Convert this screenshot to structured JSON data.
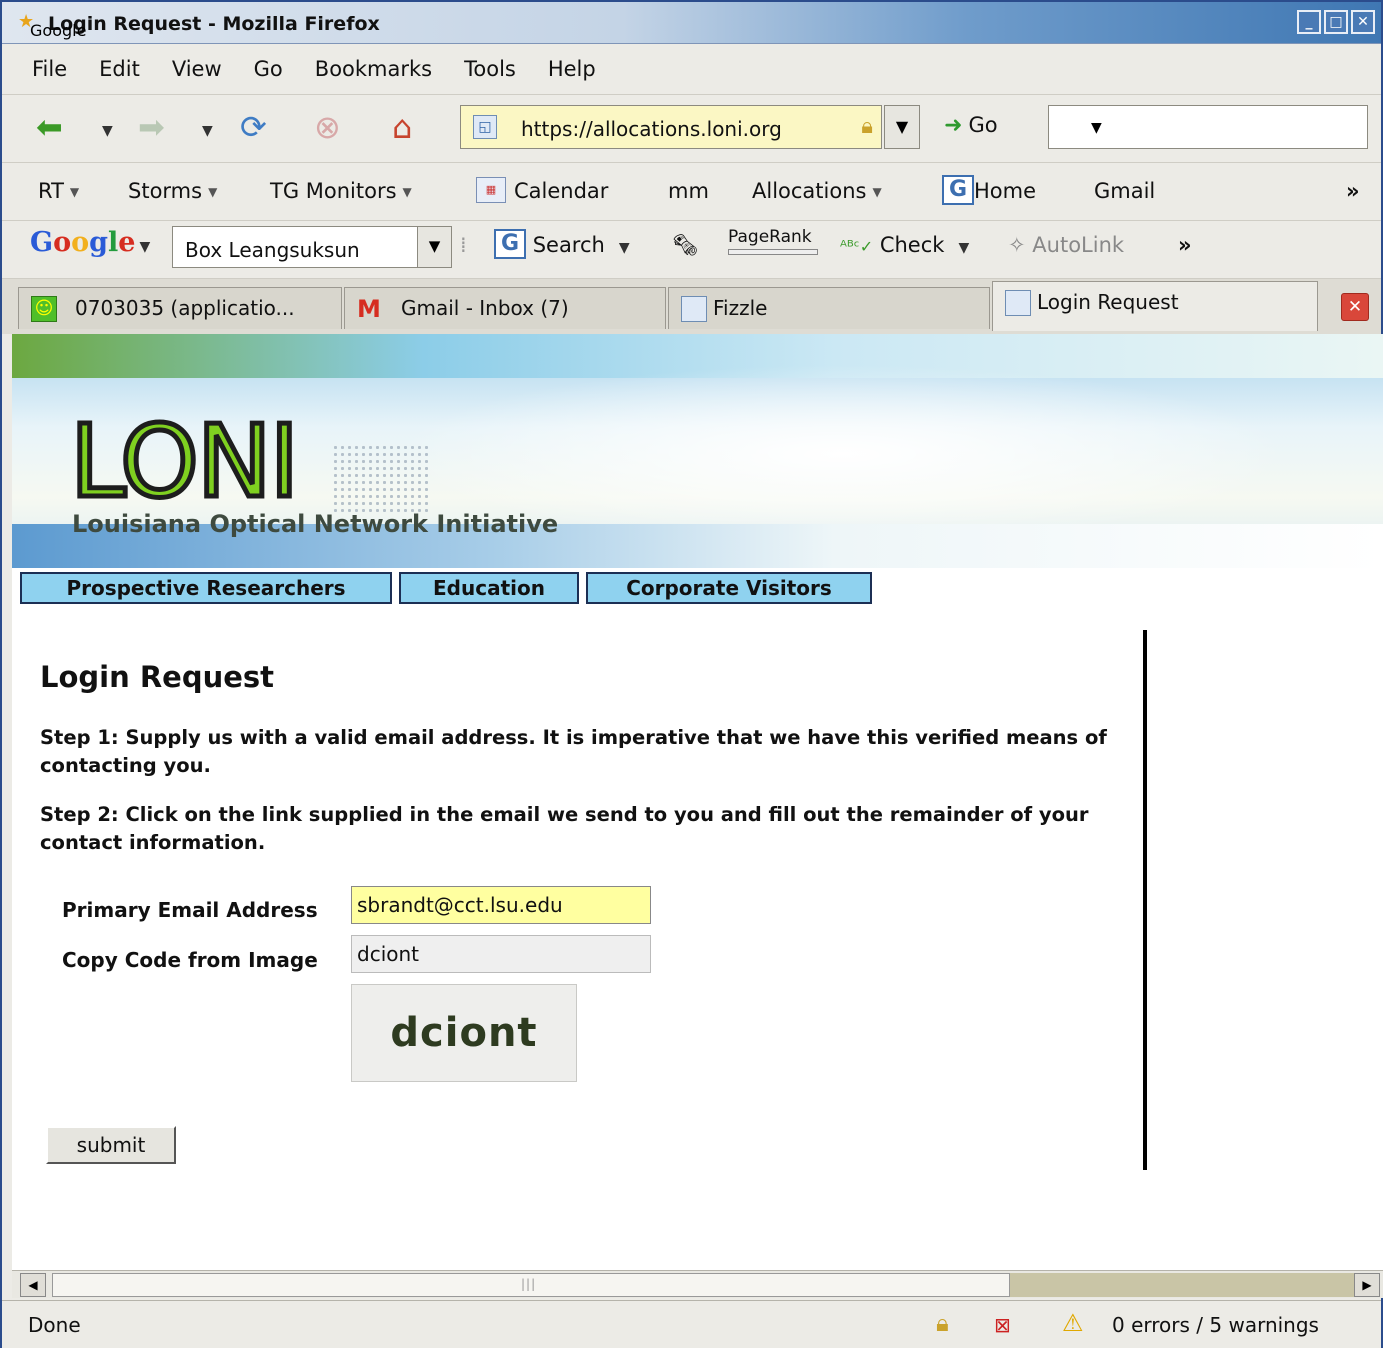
{
  "window": {
    "title": "Login Request - Mozilla Firefox"
  },
  "menubar": {
    "items": [
      "File",
      "Edit",
      "View",
      "Go",
      "Bookmarks",
      "Tools",
      "Help"
    ]
  },
  "navbar": {
    "url": "https://allocations.loni.org",
    "go_label": "Go"
  },
  "bookmarks": {
    "rt": "RT",
    "storms": "Storms",
    "tg_monitors": "TG Monitors",
    "calendar": "Calendar",
    "mm": "mm",
    "allocations": "Allocations",
    "home": "Home",
    "gmail": "Gmail",
    "more": "»"
  },
  "google_toolbar": {
    "logo": "Google",
    "query": "Box Leangsuksun",
    "search_label": "Search",
    "pagerank_label": "PageRank",
    "check_label": "Check",
    "autolink_label": "AutoLink",
    "more": "»"
  },
  "tabs": [
    {
      "label": "0703035 (applicatio..."
    },
    {
      "label": "Gmail - Inbox (7)"
    },
    {
      "label": "Fizzle"
    },
    {
      "label": "Login Request"
    }
  ],
  "banner": {
    "logo": "LONI",
    "subtitle": "Louisiana Optical Network Initiative"
  },
  "site_nav": {
    "prospective": "Prospective Researchers",
    "education": "Education",
    "corporate": "Corporate Visitors"
  },
  "page": {
    "title": "Login Request",
    "step1": "Step 1: Supply us with a valid email address. It is imperative that we have this verified means of contacting you.",
    "step2": "Step 2: Click on the link supplied in the email we send to you and fill out the remainder of your contact information.",
    "email_label": "Primary Email Address",
    "email_value": "sbrandt@cct.lsu.edu",
    "code_label": "Copy Code from Image",
    "code_value": "dciont",
    "captcha_text": "dciont",
    "submit_label": "submit"
  },
  "status": {
    "text": "Done",
    "errors": "0 errors / 5 warnings"
  },
  "colors": {
    "nav_link_bg": "#8fd2ef",
    "logo_green": "#7fd020",
    "email_field_bg": "#ffffa0",
    "url_bar_bg": "#fbf7c4"
  }
}
